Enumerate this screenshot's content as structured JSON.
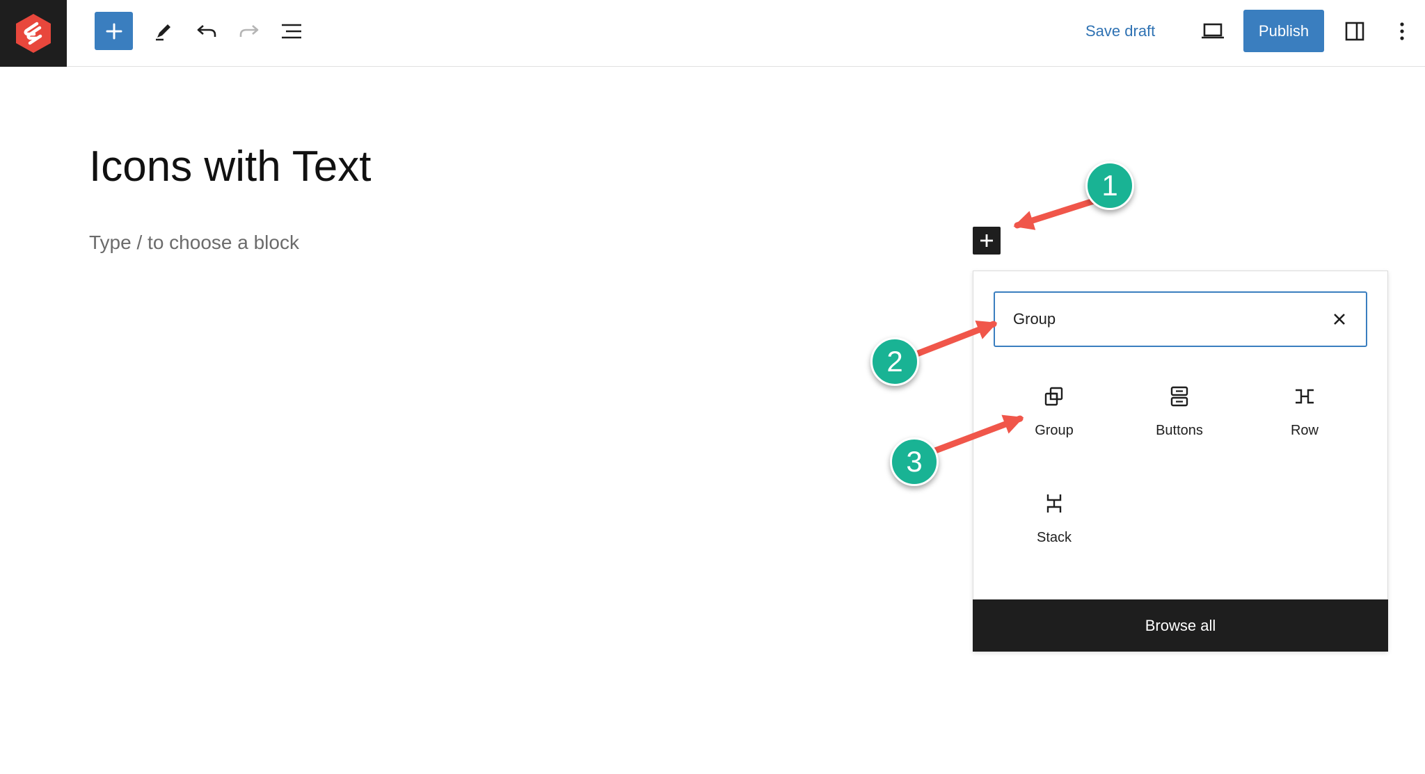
{
  "toolbar": {
    "save_draft_label": "Save draft",
    "publish_label": "Publish"
  },
  "editor": {
    "title": "Icons with Text",
    "placeholder": "Type / to choose a block"
  },
  "inserter": {
    "search_value": "Group",
    "blocks": [
      {
        "label": "Group",
        "icon": "group-icon"
      },
      {
        "label": "Buttons",
        "icon": "buttons-icon"
      },
      {
        "label": "Row",
        "icon": "row-icon"
      },
      {
        "label": "Stack",
        "icon": "stack-icon"
      }
    ],
    "browse_all_label": "Browse all"
  },
  "annotations": {
    "steps": [
      "1",
      "2",
      "3"
    ]
  },
  "colors": {
    "accent": "#3a7ebf",
    "brand_logo": "#e8473c",
    "annotation_badge": "#19b394",
    "annotation_arrow": "#f0564a"
  }
}
